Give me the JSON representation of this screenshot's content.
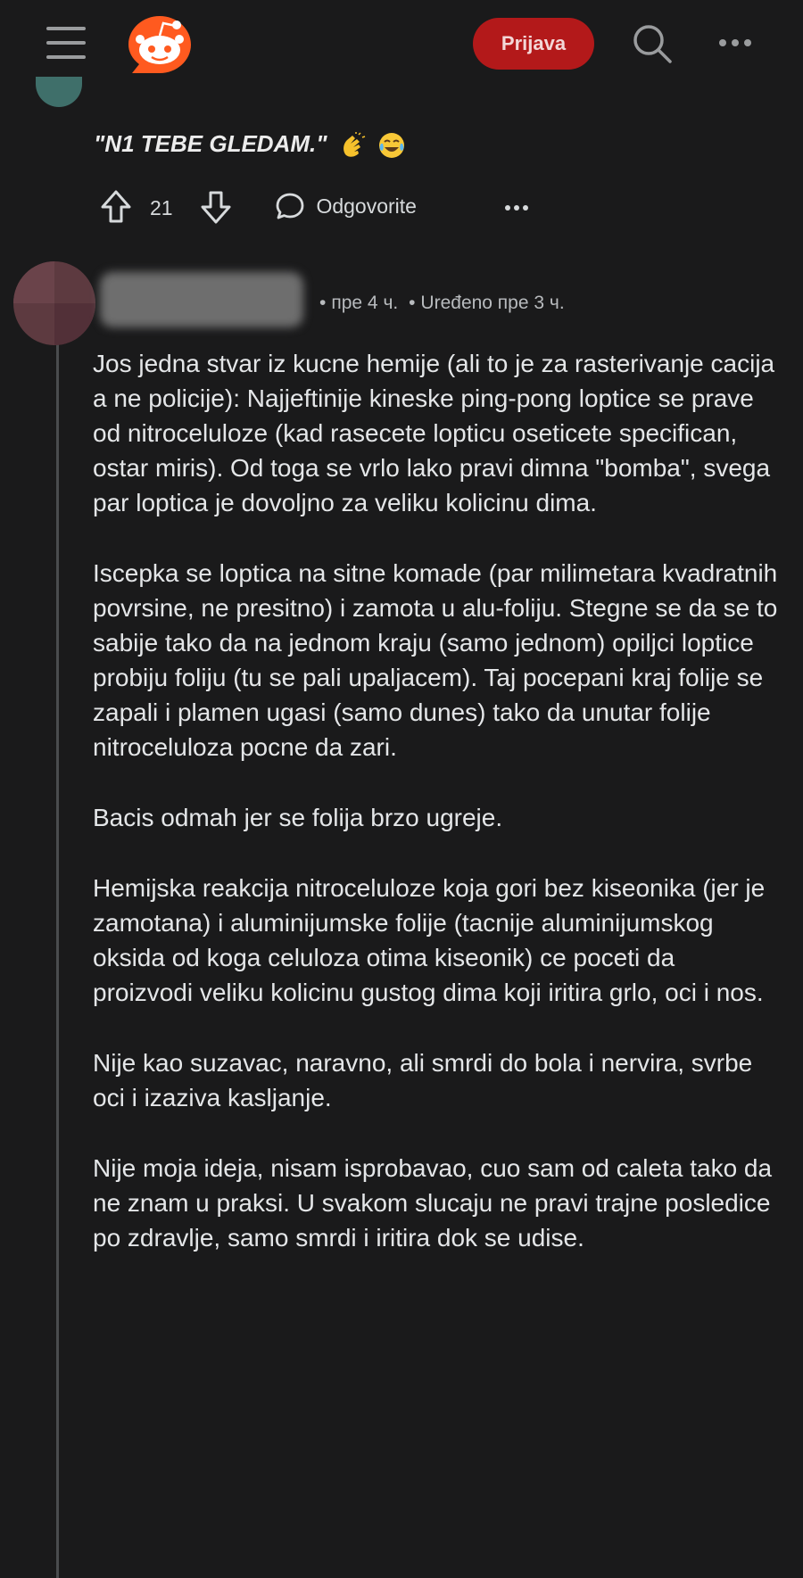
{
  "header": {
    "login_label": "Prijava",
    "menu_icon": "hamburger-icon",
    "logo_icon": "reddit-logo",
    "search_icon": "search-icon",
    "more_icon": "more-icon",
    "login_color": "#b3191a"
  },
  "previous_comment": {
    "quote": "\"N1 TEBE GLEDAM.\"",
    "emoji_1": "clapping-hands-emoji",
    "emoji_2": "tears-of-joy-emoji",
    "votes": "21",
    "reply_label": "Odgovorite"
  },
  "comment": {
    "time": "пре 4 ч.",
    "edited": "Uređeno пре 3 ч.",
    "paragraphs": [
      "Jos jedna stvar iz kucne hemije (ali to je za rasterivanje cacija a ne policije): Najjeftinije kineske ping-pong loptice se prave od nitroceluloze (kad rasecete lopticu oseticete specifican, ostar miris). Od toga se vrlo lako pravi dimna \"bomba\", svega par loptica je dovoljno za veliku kolicinu dima.",
      "Iscepka se loptica na sitne komade (par milimetara kvadratnih povrsine, ne presitno) i zamota u alu-foliju. Stegne se da se to sabije tako da na jednom kraju (samo jednom) opiljci loptice probiju foliju (tu se pali upaljacem). Taj pocepani kraj folije se zapali i plamen ugasi (samo dunes) tako da unutar folije nitroceluloza pocne da zari.",
      "Bacis odmah jer se folija brzo ugreje.",
      "Hemijska reakcija nitroceluloze koja gori bez kiseonika (jer je zamotana) i aluminijumske folije (tacnije aluminijumskog oksida od koga celuloza otima kiseonik) ce poceti da proizvodi veliku kolicinu gustog dima koji iritira grlo, oci i nos.",
      "Nije kao suzavac, naravno, ali smrdi do bola i nervira, svrbe oci i izaziva kasljanje.",
      "Nije moja ideja, nisam isprobavao, cuo sam od caleta tako da ne znam u praksi. U svakom slucaju ne pravi trajne posledice po zdravlje, samo smrdi i iritira dok se udise."
    ]
  }
}
